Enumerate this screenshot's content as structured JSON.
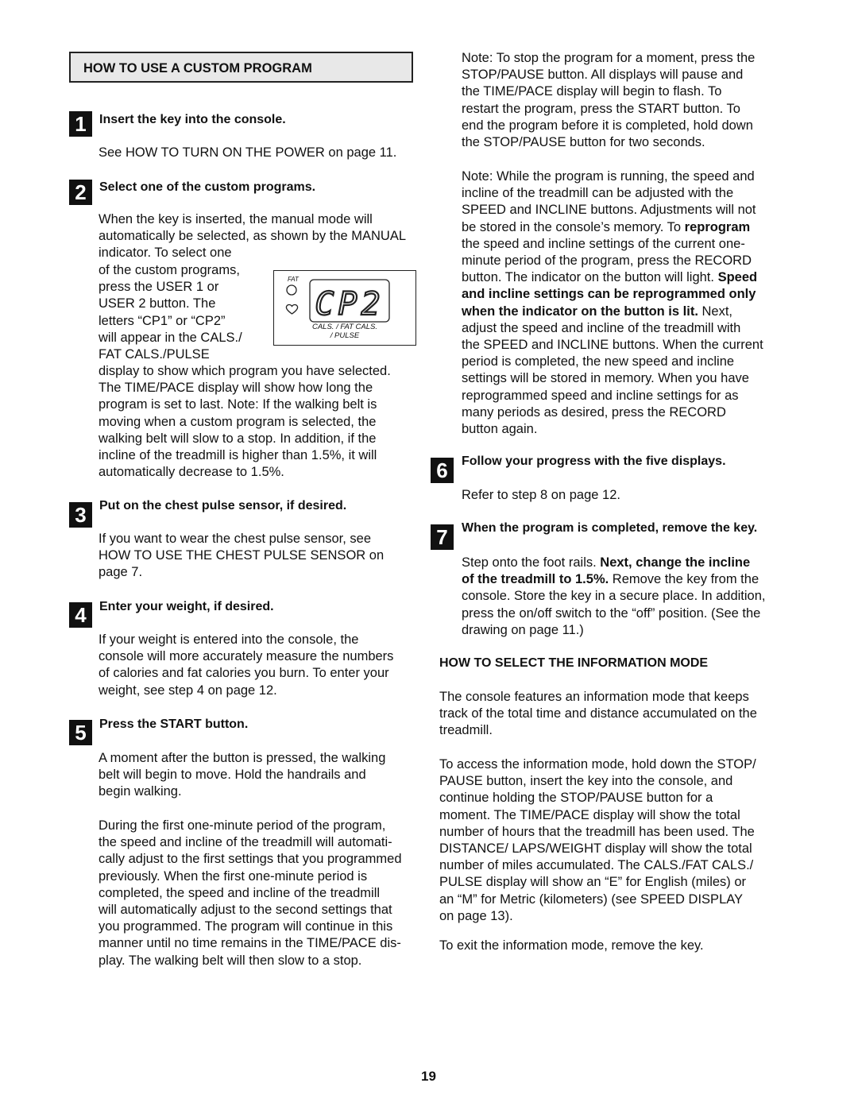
{
  "page": {
    "number": "19"
  },
  "section_custom": {
    "title": "HOW TO USE A CUSTOM PROGRAM"
  },
  "steps": [
    {
      "number": "1",
      "title": "Insert the key into the console.",
      "body": [
        "See HOW TO TURN ON THE POWER on page 11."
      ]
    },
    {
      "number": "2",
      "title": "Select one of the custom programs.",
      "body_top": [
        "When the key is inserted, the manual mode will",
        "automatically be selected, as shown by the MANUAL",
        "indicator. To select one"
      ],
      "body_wrap": [
        "of the custom programs,",
        "press the USER 1 or",
        "USER 2 button. The",
        "letters “CP1” or “CP2”",
        "will appear in the CALS./",
        "FAT CALS./PULSE"
      ],
      "body_bottom": [
        "display to show which program you have selected.",
        "The TIME/PACE display will show how long the",
        "program is set to last. Note: If the walking belt is",
        "moving when a custom program is selected, the",
        "walking belt will slow to a stop. In addition, if the",
        "incline of the treadmill is higher than 1.5%, it will",
        "automatically decrease to 1.5%."
      ]
    },
    {
      "number": "3",
      "title": "Put on the chest pulse sensor, if desired.",
      "body": [
        "If you want to wear the chest pulse sensor, see",
        "HOW TO USE THE CHEST PULSE SENSOR on",
        "page 7."
      ]
    },
    {
      "number": "4",
      "title": "Enter your weight, if desired.",
      "body": [
        "If your weight is entered into the console, the",
        "console will more accurately measure the numbers",
        "of calories and fat calories you burn. To enter your",
        "weight, see step 4 on page 12."
      ]
    },
    {
      "number": "5",
      "title": "Press the START button.",
      "body": [
        "A moment after the button is pressed, the walking",
        "belt will begin to move. Hold the handrails and",
        "begin walking."
      ],
      "body2": [
        "During the first one-minute period of the program,",
        "the speed and incline of the treadmill will automati-",
        "cally adjust to the first settings that you programmed",
        "previously. When the first one-minute period is",
        "completed, the speed and incline of the treadmill",
        "will automatically adjust to the second settings that",
        "you programmed. The program will continue in this",
        "manner until no time remains in the TIME/PACE dis-",
        "play. The walking belt will then slow to a stop."
      ]
    },
    {
      "number": "6",
      "title": "Follow your progress with the five displays.",
      "body": [
        "Refer to step 8 on page 12."
      ]
    },
    {
      "number": "7",
      "title": "When the program is completed, remove the key.",
      "body_rich": [
        [
          {
            "t": "Step onto the foot rails. ",
            "b": false
          },
          {
            "t": "Next, change the incline",
            "b": true
          }
        ],
        [
          {
            "t": "of the treadmill to 1.5%.",
            "b": true
          },
          {
            "t": " Remove the key from the",
            "b": false
          }
        ],
        [
          {
            "t": "console. Store the key in a secure place. In addition,",
            "b": false
          }
        ],
        [
          {
            "t": "press the on/off switch to the “off” position. (See the",
            "b": false
          }
        ],
        [
          {
            "t": "drawing on page 11.)",
            "b": false
          }
        ]
      ]
    }
  ],
  "notes": {
    "stop_note": [
      "Note: To stop the program for a moment, press the",
      "STOP/PAUSE button. All displays will pause and",
      "the TIME/PACE display will begin to flash. To",
      "restart the program, press the START button. To",
      "end the program before it is completed, hold down",
      "the STOP/PAUSE button for two seconds."
    ],
    "reprogram_note": [
      [
        {
          "t": "Note: While the program is running, the speed and",
          "b": false
        }
      ],
      [
        {
          "t": "incline of the treadmill can be adjusted with the",
          "b": false
        }
      ],
      [
        {
          "t": "SPEED and INCLINE buttons. Adjustments will not",
          "b": false
        }
      ],
      [
        {
          "t": "be stored in the console’s memory. To ",
          "b": false
        },
        {
          "t": "reprogram",
          "b": true
        }
      ],
      [
        {
          "t": "the speed and incline settings of the current one-",
          "b": false
        }
      ],
      [
        {
          "t": "minute period of the program, press the RECORD",
          "b": false
        }
      ],
      [
        {
          "t": "button. The indicator on the button will light. ",
          "b": false
        },
        {
          "t": "Speed",
          "b": true
        }
      ],
      [
        {
          "t": "and incline settings can be reprogrammed only",
          "b": true
        }
      ],
      [
        {
          "t": "when the indicator on the button is lit.",
          "b": true
        },
        {
          "t": " Next,",
          "b": false
        }
      ],
      [
        {
          "t": "adjust the speed and incline of the treadmill with",
          "b": false
        }
      ],
      [
        {
          "t": "the SPEED and INCLINE buttons. When the current",
          "b": false
        }
      ],
      [
        {
          "t": "period is completed, the new speed and incline",
          "b": false
        }
      ],
      [
        {
          "t": "settings will be stored in memory. When you have",
          "b": false
        }
      ],
      [
        {
          "t": "reprogrammed speed and incline settings for as",
          "b": false
        }
      ],
      [
        {
          "t": "many periods as desired, press the RECORD",
          "b": false
        }
      ],
      [
        {
          "t": "button again.",
          "b": false
        }
      ]
    ]
  },
  "section_info": {
    "title": "HOW TO SELECT THE INFORMATION MODE",
    "para1": [
      "The console features an information mode that keeps",
      "track of the total time and distance accumulated on the",
      "treadmill."
    ],
    "para2": [
      "To access the information mode, hold down the STOP/",
      "PAUSE button, insert the key into the console, and",
      "continue holding the STOP/PAUSE button for a",
      "moment. The TIME/PACE display will show the total",
      "number of hours that the treadmill has been used. The",
      "DISTANCE/ LAPS/WEIGHT display will show the total",
      "number of miles accumulated. The CALS./FAT CALS./",
      "PULSE display will show an “E” for English (miles) or",
      "an “M” for Metric (kilometers) (see SPEED DISPLAY",
      "on page 13)."
    ],
    "para3": [
      "To exit the information mode, remove the key."
    ]
  },
  "figure": {
    "fat_label": "FAT",
    "display_text": "CP2",
    "caption_line1": "CALS. / FAT CALS.",
    "caption_line2": "/ PULSE",
    "icons": [
      "fat-indicator-circle-icon",
      "heart-icon"
    ]
  }
}
